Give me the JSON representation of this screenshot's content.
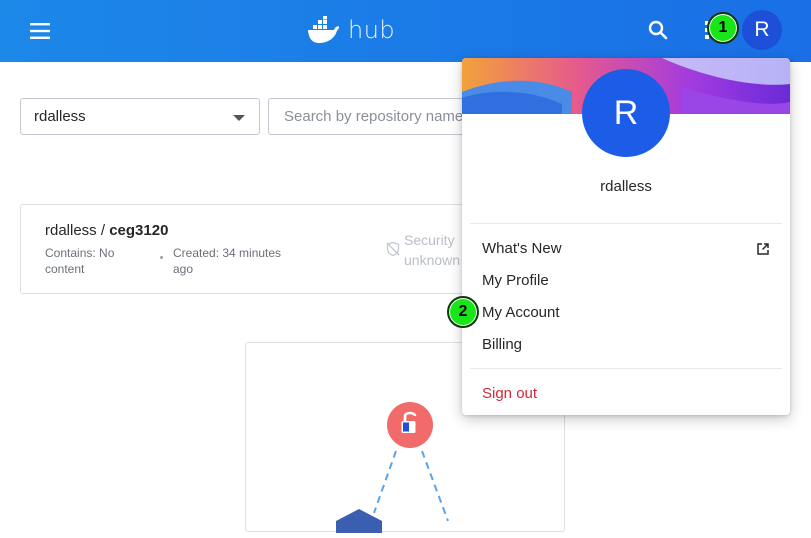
{
  "header": {
    "logo_text": "hub",
    "avatar_initial": "R"
  },
  "filters": {
    "owner_value": "rdalless",
    "search_placeholder": "Search by repository name"
  },
  "repository": {
    "namespace": "rdalless",
    "separator": " / ",
    "name": "ceg3120",
    "contains": "Contains: No content",
    "created": "Created: 34 minutes ago",
    "security_line1": "Security",
    "security_line2": "unknown"
  },
  "dropdown": {
    "avatar_initial": "R",
    "username": "rdalless",
    "items": [
      {
        "label": "What's New"
      },
      {
        "label": "My Profile"
      },
      {
        "label": "My Account"
      },
      {
        "label": "Billing"
      }
    ],
    "sign_out": "Sign out"
  },
  "markers": [
    {
      "label": "1"
    },
    {
      "label": "2"
    }
  ],
  "colors": {
    "header_blue": "#1a6fe6",
    "avatar_blue": "#1d4fd8",
    "sign_out_red": "#d2283a",
    "marker_green": "#19e619",
    "lock_red": "#f26b6b"
  },
  "icons": [
    "menu-icon",
    "docker-whale-icon",
    "search-icon",
    "apps-grid-icon",
    "external-link-icon",
    "security-off-icon",
    "lock-icon"
  ]
}
